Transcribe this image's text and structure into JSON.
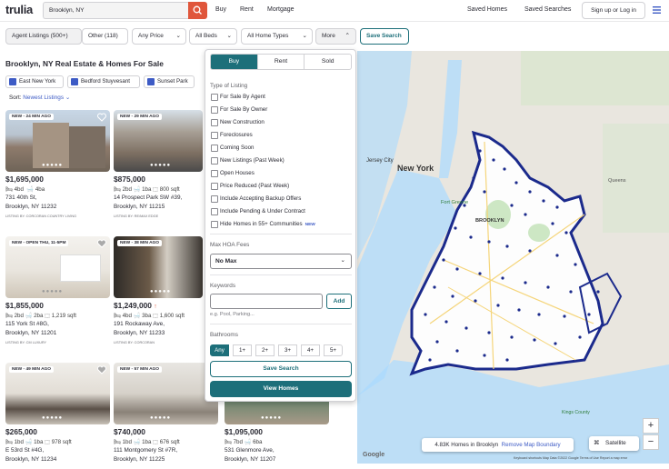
{
  "header": {
    "logo": "trulia",
    "search_value": "Brooklyn, NY",
    "nav": [
      "Buy",
      "Rent",
      "Mortgage"
    ],
    "saved_homes": "Saved Homes",
    "saved_searches": "Saved Searches",
    "sign_in": "Sign up or Log in"
  },
  "filters": {
    "agent_listings": "Agent Listings (500+)",
    "other": "Other (118)",
    "price": "Any Price",
    "beds": "All Beds",
    "home_types": "All Home Types",
    "more": "More",
    "save_search": "Save Search"
  },
  "results": {
    "title": "Brooklyn, NY Real Estate & Homes For Sale",
    "chips": [
      "East New York",
      "Bedford Stuyvesant",
      "Sunset Park"
    ],
    "sort_label": "Sort:",
    "sort_value": "Newest Listings"
  },
  "listings": [
    {
      "badge": "NEW - 24 MIN AGO",
      "price": "$1,695,000",
      "beds": "4bd",
      "baths": "4ba",
      "sqft": "",
      "addr1": "731 40th St,",
      "addr2": "Brooklyn, NY 11232",
      "broker": "LISTING BY: CORCORAN COUNTRY LIVING"
    },
    {
      "badge": "NEW - 29 MIN AGO",
      "price": "$875,000",
      "beds": "2bd",
      "baths": "1ba",
      "sqft": "800 sqft",
      "addr1": "14 Prospect Park SW #39,",
      "addr2": "Brooklyn, NY 11215",
      "broker": "LISTING BY: RE/MAX EDGE"
    },
    {
      "badge": "NEW - OPEN THU, 11-5PM",
      "price": "$1,855,000",
      "beds": "2bd",
      "baths": "2ba",
      "sqft": "1,219 sqft",
      "addr1": "115 York St #8G,",
      "addr2": "Brooklyn, NY 11201",
      "broker": "LISTING BY: CM LUXURY"
    },
    {
      "badge": "NEW - 38 MIN AGO",
      "price": "$1,249,000",
      "beds": "4bd",
      "baths": "3ba",
      "sqft": "1,600 sqft",
      "addr1": "191 Rockaway Ave,",
      "addr2": "Brooklyn, NY 11233",
      "broker": "LISTING BY: CORCORAN"
    },
    {
      "badge": "NEW - 49 MIN AGO",
      "price": "$265,000",
      "beds": "1bd",
      "baths": "1ba",
      "sqft": "978 sqft",
      "addr1": "E 53rd St #4G,",
      "addr2": "Brooklyn, NY 11234",
      "broker": ""
    },
    {
      "badge": "NEW - 57 MIN AGO",
      "price": "$740,000",
      "beds": "1bd",
      "baths": "1ba",
      "sqft": "676 sqft",
      "addr1": "111 Montgomery St #7R,",
      "addr2": "Brooklyn, NY 11225",
      "broker": ""
    },
    {
      "badge": "",
      "price": "$1,095,000",
      "beds": "7bd",
      "baths": "6ba",
      "sqft": "",
      "addr1": "531 Glenmore Ave,",
      "addr2": "Brooklyn, NY 11207",
      "broker": ""
    }
  ],
  "more_panel": {
    "tabs": [
      "Buy",
      "Rent",
      "Sold"
    ],
    "type_title": "Type of Listing",
    "options": [
      "For Sale By Agent",
      "For Sale By Owner",
      "New Construction",
      "Foreclosures",
      "Coming Soon",
      "New Listings (Past Week)",
      "Open Houses",
      "Price Reduced (Past Week)",
      "Include Accepting Backup Offers",
      "Include Pending & Under Contract",
      "Hide Homes in 55+ Communities"
    ],
    "new_badge": "NEW",
    "hoa_title": "Max HOA Fees",
    "hoa_value": "No Max",
    "keywords_title": "Keywords",
    "add_label": "Add",
    "keyword_hint": "e.g. Pool, Parking...",
    "bath_title": "Bathrooms",
    "bath_options": [
      "Any",
      "1+",
      "2+",
      "3+",
      "4+",
      "5+"
    ],
    "save_search": "Save Search",
    "view_homes": "View Homes"
  },
  "map": {
    "labels": [
      "Jersey City",
      "New York",
      "Fort Greene",
      "BROOKLYN",
      "Queens",
      "Kings County"
    ],
    "homes_count": "4.83K Homes in Brooklyn",
    "remove_boundary": "Remove Map Boundary",
    "satellite": "Satellite",
    "zoom_in": "+",
    "zoom_out": "−",
    "google": "Google",
    "attribution": "Keyboard shortcuts   Map Data ©2022 Google   Terms of Use   Report a map error"
  },
  "colors": {
    "accent": "#1d6f7a",
    "brand_red": "#e0563b",
    "link_blue": "#3d5bc5",
    "boundary": "#1b2a8c"
  }
}
